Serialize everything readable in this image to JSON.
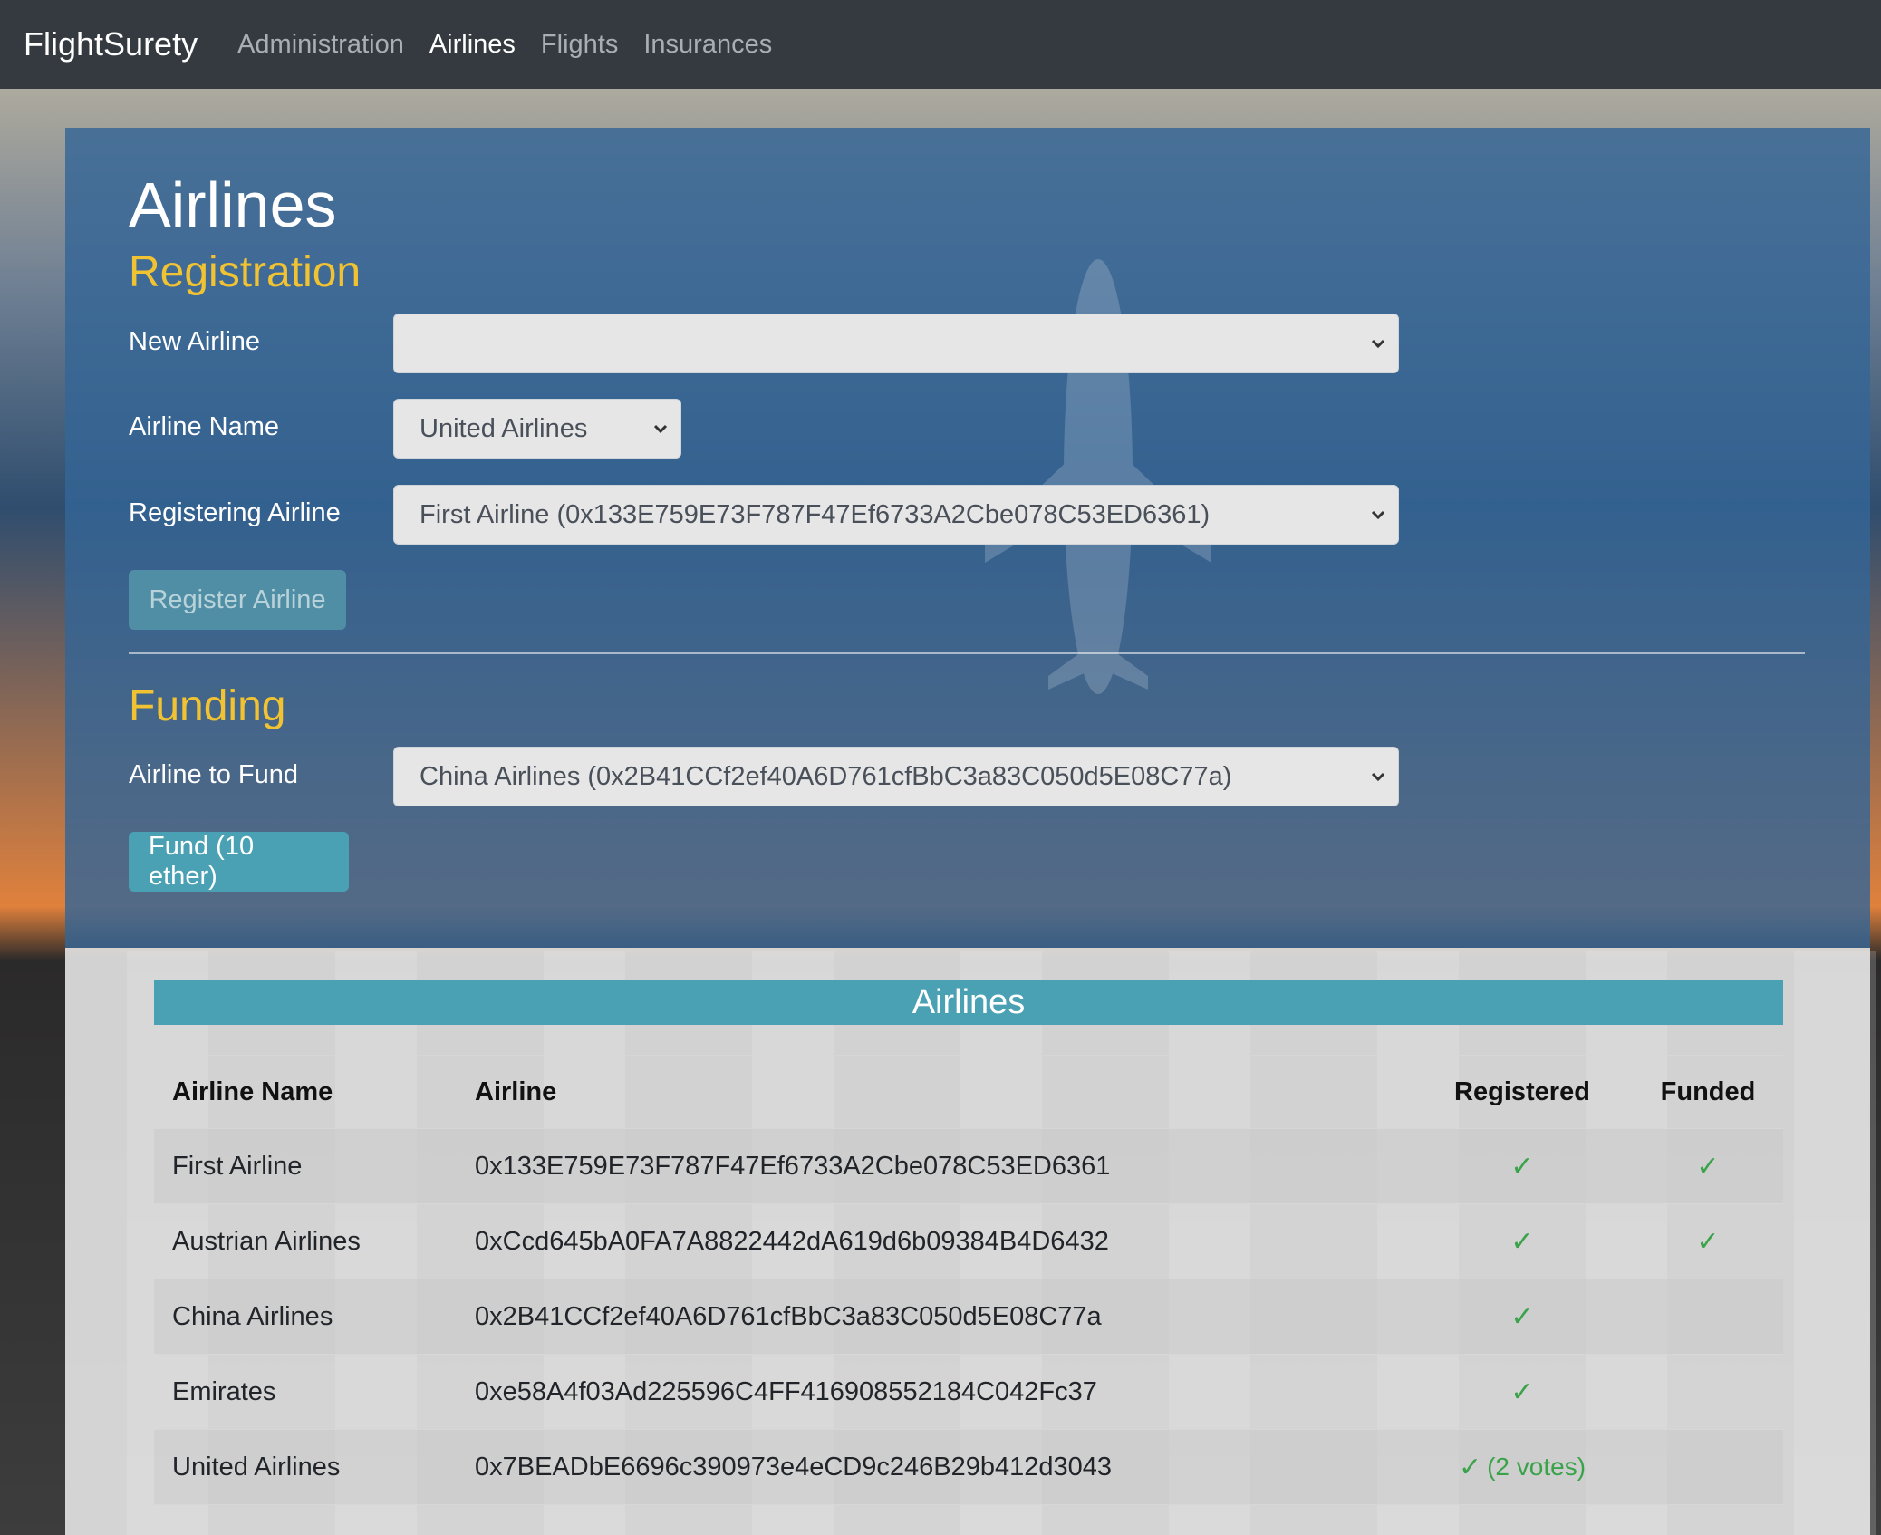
{
  "navbar": {
    "brand": "FlightSurety",
    "links": [
      "Administration",
      "Airlines",
      "Flights",
      "Insurances"
    ],
    "active": "Airlines"
  },
  "page": {
    "title": "Airlines"
  },
  "registration": {
    "title": "Registration",
    "new_airline": {
      "label": "New Airline",
      "value": ""
    },
    "airline_name": {
      "label": "Airline Name",
      "value": "United Airlines"
    },
    "registering_airline": {
      "label": "Registering Airline",
      "value": "First Airline (0x133E759E73F787F47Ef6733A2Cbe078C53ED6361)"
    },
    "button": "Register Airline"
  },
  "funding": {
    "title": "Funding",
    "airline_to_fund": {
      "label": "Airline to Fund",
      "value": "China Airlines (0x2B41CCf2ef40A6D761cfBbC3a83C050d5E08C77a)"
    },
    "button": "Fund (10 ether)"
  },
  "airlines_table": {
    "title": "Airlines",
    "columns": [
      "Airline Name",
      "Airline",
      "Registered",
      "Funded"
    ],
    "rows": [
      {
        "name": "First Airline",
        "address": "0x133E759E73F787F47Ef6733A2Cbe078C53ED6361",
        "registered": "✓",
        "funded": "✓",
        "votes": ""
      },
      {
        "name": "Austrian Airlines",
        "address": "0xCcd645bA0FA7A8822442dA619d6b09384B4D6432",
        "registered": "✓",
        "funded": "✓",
        "votes": ""
      },
      {
        "name": "China Airlines",
        "address": "0x2B41CCf2ef40A6D761cfBbC3a83C050d5E08C77a",
        "registered": "✓",
        "funded": "",
        "votes": ""
      },
      {
        "name": "Emirates",
        "address": "0xe58A4f03Ad225596C4FF416908552184C042Fc37",
        "registered": "✓",
        "funded": "",
        "votes": ""
      },
      {
        "name": "United Airlines",
        "address": "0x7BEADbE6696c390973e4eCD9c246B29b412d3043",
        "registered": "✓",
        "funded": "",
        "votes": "(2 votes)"
      }
    ]
  },
  "colors": {
    "navbar": "#343a40",
    "accent_teal": "#4aa1b4",
    "section_title": "#f1c232",
    "check_green": "#3aa34a"
  }
}
